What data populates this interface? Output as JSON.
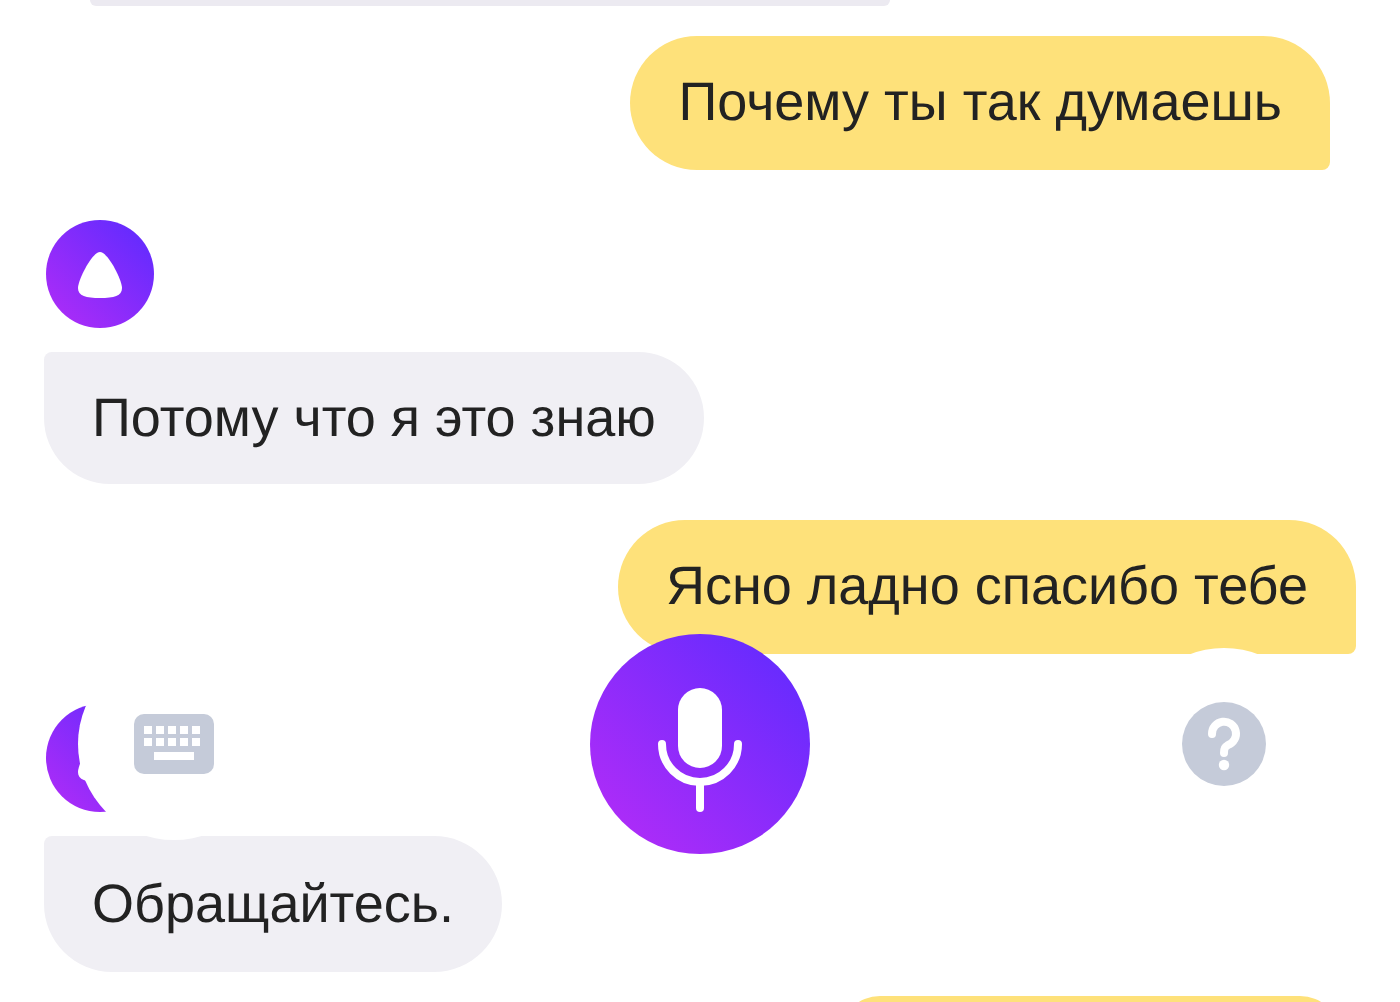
{
  "messages": [
    {
      "kind": "incoming-cut"
    },
    {
      "kind": "outgoing",
      "text": "Почему ты так думаешь"
    },
    {
      "kind": "avatar"
    },
    {
      "kind": "incoming",
      "text": "Потому что я это знаю"
    },
    {
      "kind": "outgoing",
      "text": "Ясно ладно спасибо тебе"
    },
    {
      "kind": "avatar"
    },
    {
      "kind": "incoming",
      "text": "Обращайтесь."
    },
    {
      "kind": "outgoing-cut"
    }
  ],
  "controls": [
    {
      "kind": "keyboard"
    },
    {
      "kind": "microphone"
    },
    {
      "kind": "help"
    }
  ]
}
